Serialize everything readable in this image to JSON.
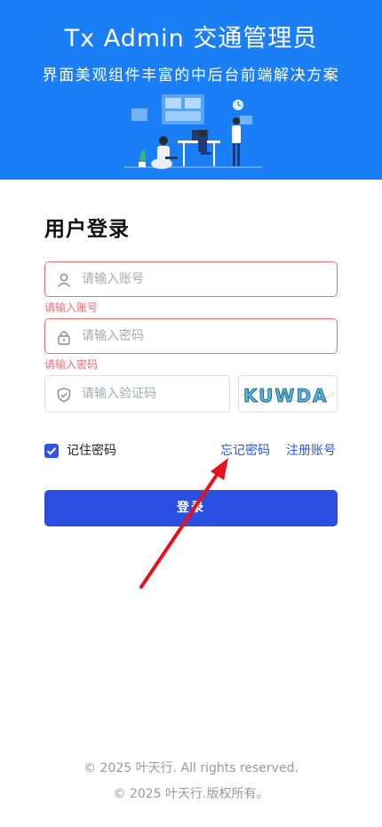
{
  "header": {
    "title": "Tx Admin  交通管理员",
    "subtitle": "界面美观组件丰富的中后台前端解决方案"
  },
  "login": {
    "title": "用户登录",
    "account_placeholder": "请输入账号",
    "account_error": "请输入账号",
    "password_placeholder": "请输入密码",
    "password_error": "请输入密码",
    "captcha_placeholder": "请输入验证码",
    "captcha_text": "KUWDA",
    "remember_label": "记住密码",
    "remember_checked": true,
    "forgot_link": "忘记密码",
    "register_link": "注册账号",
    "submit_label": "登录"
  },
  "footer": {
    "line1": "© 2025 叶天行. All rights reserved.",
    "line2": "© 2025 叶天行.版权所有。"
  },
  "colors": {
    "header_bg": "#1a7ef6",
    "primary": "#2b4fe0",
    "link": "#2f54eb",
    "error": "#f56c6c",
    "annotation_arrow": "#e8121c"
  },
  "icons": [
    "user-icon",
    "lock-icon",
    "shield-check-icon",
    "checkmark-icon"
  ]
}
